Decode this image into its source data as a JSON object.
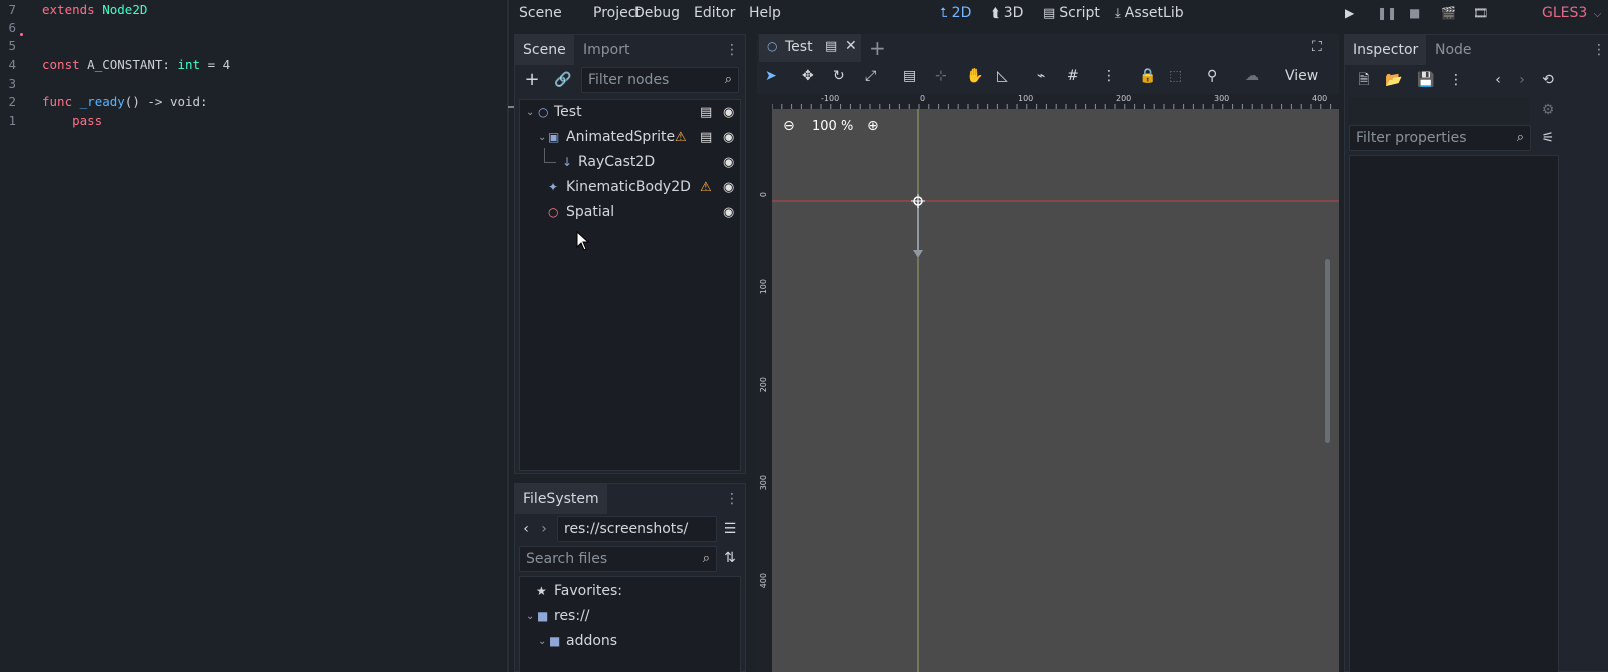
{
  "code": {
    "lines": [
      {
        "num": "7",
        "segments": [
          {
            "t": "extends",
            "c": "kw"
          },
          {
            "t": " ",
            "c": "id"
          },
          {
            "t": "Node2D",
            "c": "ty"
          }
        ]
      },
      {
        "num": "6",
        "segments": []
      },
      {
        "num": "5",
        "segments": []
      },
      {
        "num": "3",
        "segments": []
      },
      {
        "num": "4",
        "segments": [
          {
            "t": "const",
            "c": "kw"
          },
          {
            "t": " A_CONSTANT: ",
            "c": "id"
          },
          {
            "t": "int",
            "c": "ty"
          },
          {
            "t": " = 4",
            "c": "id"
          }
        ]
      },
      {
        "num": "3",
        "segments": []
      },
      {
        "num": "2",
        "segments": [
          {
            "t": "func",
            "c": "kw"
          },
          {
            "t": " ",
            "c": "id"
          },
          {
            "t": "_ready",
            "c": "fn"
          },
          {
            "t": "() -> void:",
            "c": "id"
          }
        ]
      },
      {
        "num": "1",
        "segments": [
          {
            "t": "    pass",
            "c": "kw"
          }
        ]
      }
    ]
  },
  "menu": {
    "scene": "Scene",
    "project": "Project",
    "debug": "Debug",
    "editor": "Editor",
    "help": "Help"
  },
  "workspaces": {
    "w2d": "2D",
    "w3d": "3D",
    "script": "Script",
    "assetlib": "AssetLib"
  },
  "renderer": "GLES3",
  "scene_dock": {
    "tab_scene": "Scene",
    "tab_import": "Import",
    "filter_placeholder": "Filter nodes",
    "nodes": [
      {
        "label": "Test",
        "icon": "node2d-icon"
      },
      {
        "label": "AnimatedSprite",
        "icon": "animated-sprite-icon"
      },
      {
        "label": "RayCast2D",
        "icon": "raycast-icon"
      },
      {
        "label": "KinematicBody2D",
        "icon": "kinematic-body-icon"
      },
      {
        "label": "Spatial",
        "icon": "spatial-icon"
      }
    ]
  },
  "filesystem_dock": {
    "tab": "FileSystem",
    "path": "res://screenshots/",
    "search_placeholder": "Search files",
    "items": [
      {
        "label": "Favorites:"
      },
      {
        "label": "res://"
      },
      {
        "label": "addons"
      }
    ]
  },
  "viewport": {
    "tab_label": "Test",
    "zoom": "100 %",
    "view_label": "View",
    "ruler_top": [
      "-100",
      "0",
      "100",
      "200",
      "300",
      "400"
    ],
    "ruler_left": [
      "0",
      "100",
      "200",
      "300",
      "400"
    ]
  },
  "inspector": {
    "tab_inspector": "Inspector",
    "tab_node": "Node",
    "filter_placeholder": "Filter properties"
  }
}
